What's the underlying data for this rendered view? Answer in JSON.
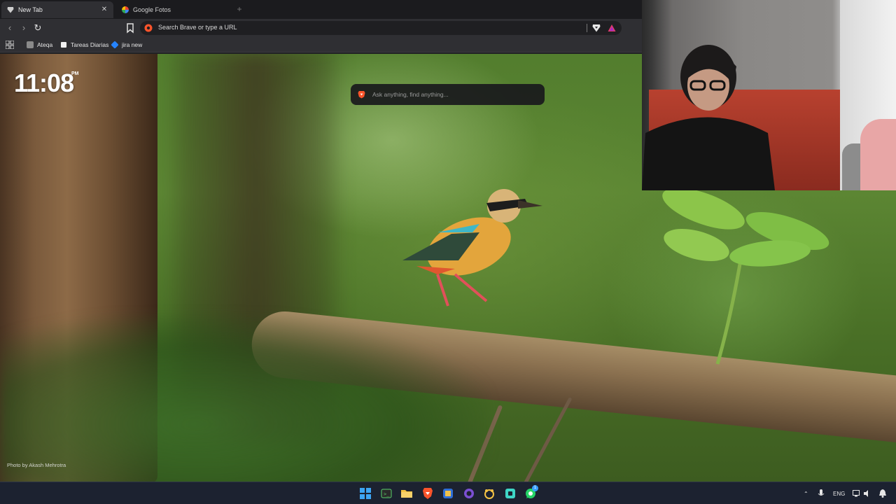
{
  "browser": {
    "tabs": [
      {
        "label": "New Tab",
        "icon": "brave-shield-icon",
        "active": true
      },
      {
        "label": "Google Fotos",
        "icon": "google-photos-icon",
        "active": false
      }
    ],
    "address_bar": {
      "placeholder": "Search Brave or type a URL"
    },
    "bookmarks": [
      {
        "label": "Ateqa",
        "icon": "bookmark-site-icon"
      },
      {
        "label": "Tareas Diarias",
        "icon": "notion-icon"
      },
      {
        "label": "jira new",
        "icon": "jira-icon"
      }
    ]
  },
  "newtab": {
    "clock": "11:08",
    "ampm": "PM",
    "search_placeholder": "Ask anything, find anything...",
    "photo_credit": "Photo by Akash Mehrotra"
  },
  "taskbar": {
    "apps": [
      {
        "name": "windows-start-icon"
      },
      {
        "name": "terminal-app-icon"
      },
      {
        "name": "file-explorer-icon"
      },
      {
        "name": "brave-browser-icon"
      },
      {
        "name": "teams-app-icon"
      },
      {
        "name": "github-desktop-icon"
      },
      {
        "name": "bear-app-icon"
      },
      {
        "name": "screen-recorder-icon"
      },
      {
        "name": "whatsapp-icon"
      }
    ],
    "whatsapp_badge": "1",
    "language": "ENG"
  },
  "colors": {
    "chrome_bg": "#202124",
    "toolbar_bg": "#2f2f33",
    "brave_orange": "#fb542b",
    "taskbar_bg": "#1c2230"
  }
}
